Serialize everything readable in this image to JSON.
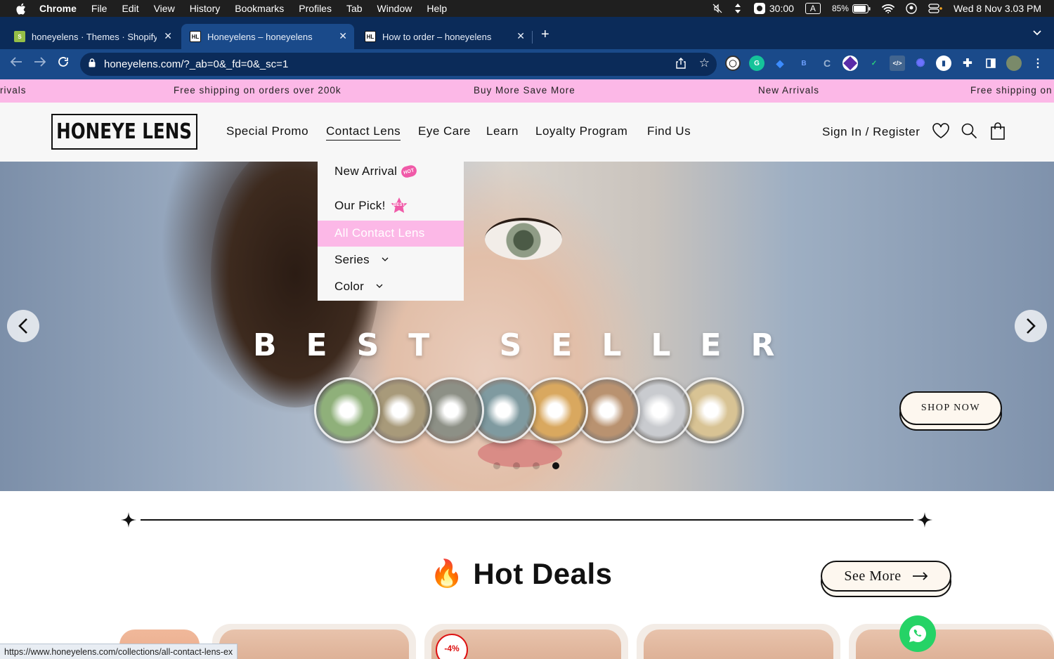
{
  "menubar": {
    "app": "Chrome",
    "items": [
      "File",
      "Edit",
      "View",
      "History",
      "Bookmarks",
      "Profiles",
      "Tab",
      "Window",
      "Help"
    ],
    "timer": "30:00",
    "input_source": "A",
    "battery": "85%",
    "datetime": "Wed 8 Nov  3.03 PM"
  },
  "tabs": [
    {
      "title": "honeyelens · Themes · Shopify",
      "favicon": "shopify-icon",
      "active": false
    },
    {
      "title": "Honeyelens – honeyelens",
      "favicon": "HL",
      "active": true
    },
    {
      "title": "How to order – honeyelens",
      "favicon": "HL",
      "active": false
    }
  ],
  "omnibox": {
    "url": "honeyelens.com/?_ab=0&_fd=0&_sc=1"
  },
  "announcement": [
    "rivals",
    "Free shipping on orders over 200k",
    "Buy More Save More",
    "New Arrivals",
    "Free shipping on"
  ],
  "header": {
    "logo": "HONEYE LENS",
    "nav": [
      "Special Promo",
      "Contact Lens",
      "Eye Care",
      "Learn",
      "Loyalty Program",
      "Find Us"
    ],
    "signin": "Sign In / Register"
  },
  "dropdown": {
    "items": [
      "New Arrival",
      "Our Pick!",
      "All Contact Lens",
      "Series",
      "Color"
    ],
    "badges": {
      "hot": "HOT",
      "best": "BEST"
    }
  },
  "hero": {
    "headline": "BEST SELLER",
    "cta": "SHOP NOW",
    "slides": 4,
    "active_slide": 4,
    "lens_colors": [
      "#8fb07a",
      "#a89a7a",
      "#8d9086",
      "#7f9aa0",
      "#d9a85f",
      "#b99270",
      "#c9cbcf",
      "#d8c394"
    ]
  },
  "section": {
    "title": "Hot Deals",
    "emoji": "🔥",
    "see_more": "See More",
    "discount_badge": "-4%"
  },
  "status_url": "https://www.honeyelens.com/collections/all-contact-lens-ex",
  "colors": {
    "accent_pink": "#fcb8e7",
    "chrome_dark": "#0b2b59",
    "chrome_toolbar": "#1a4a8a"
  }
}
